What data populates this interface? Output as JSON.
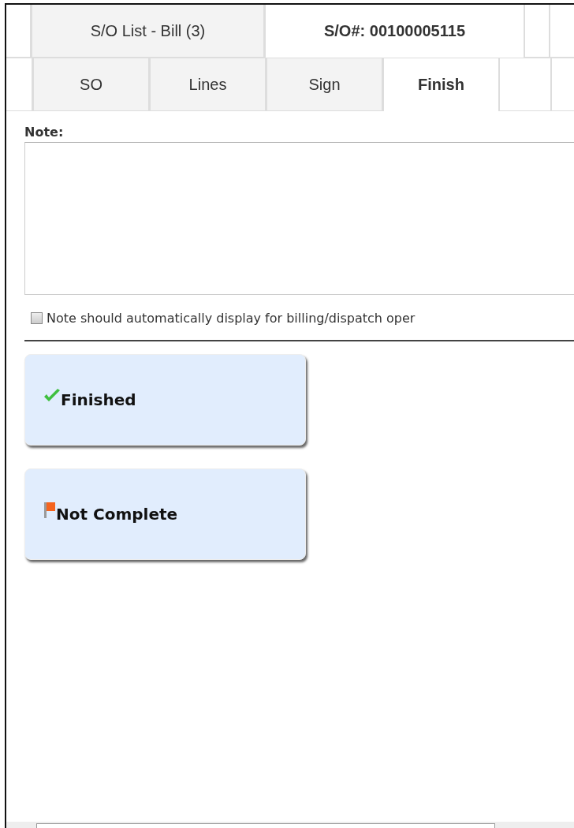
{
  "top_tabs": [
    {
      "label": "S/O List - Bill (3)",
      "selected": false
    },
    {
      "label": "S/O#: 00100005115",
      "selected": true
    }
  ],
  "tabs": [
    {
      "label": "SO",
      "selected": false
    },
    {
      "label": "Lines",
      "selected": false
    },
    {
      "label": "Sign",
      "selected": false
    },
    {
      "label": "Finish",
      "selected": true
    }
  ],
  "note": {
    "label": "Note:",
    "checkbox": {
      "label": "Note should automatically display for billing/dispatch oper",
      "checked": false
    }
  },
  "actions": [
    {
      "label": "Finished",
      "kind": "check"
    },
    {
      "label": "Not Complete",
      "kind": "flag"
    }
  ]
}
